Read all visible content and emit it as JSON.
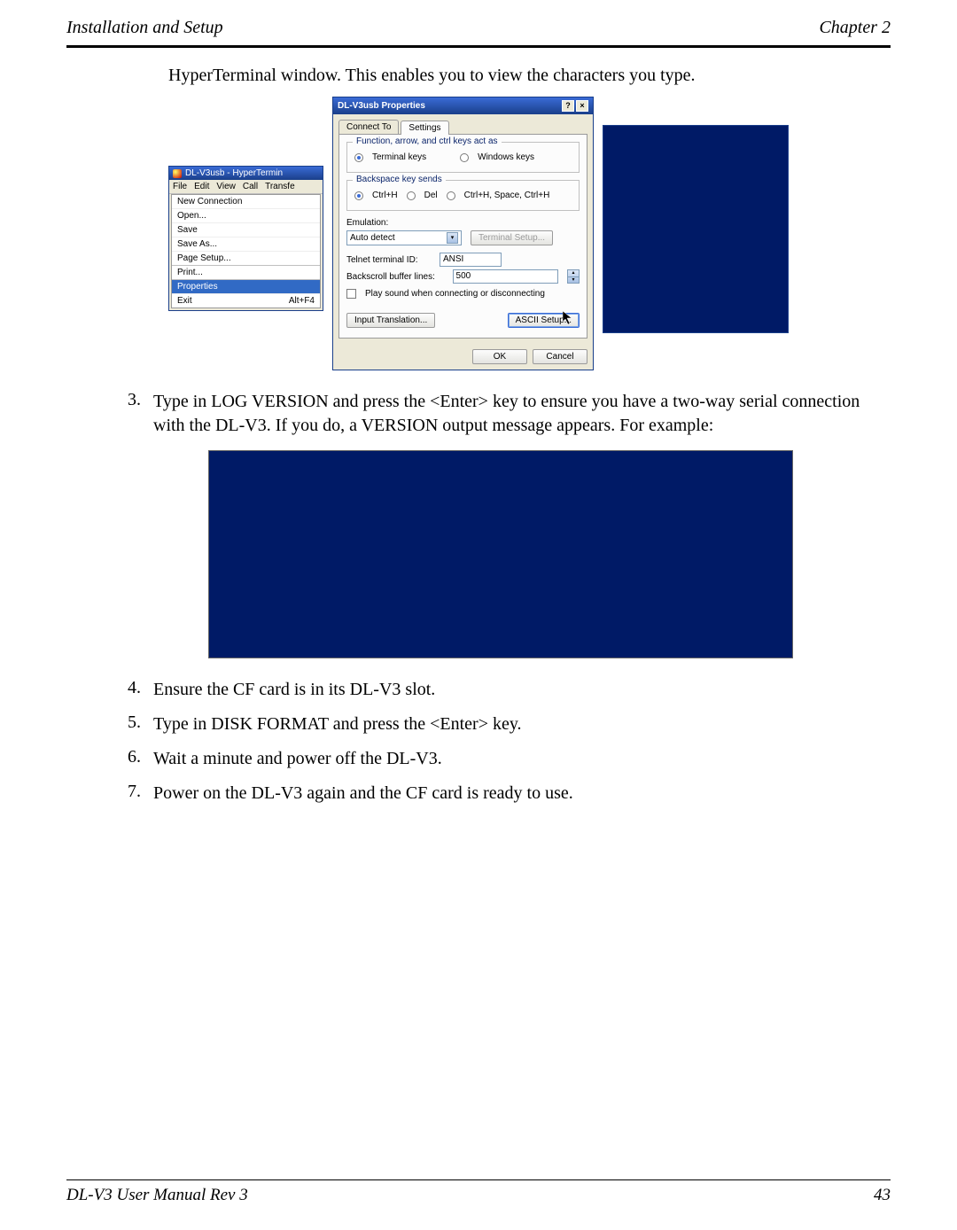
{
  "header": {
    "left": "Installation and Setup",
    "right": "Chapter 2"
  },
  "intro": "HyperTerminal window. This enables you to view the characters you type.",
  "ht": {
    "title": "DL-V3usb - HyperTermin",
    "menubar": [
      "File",
      "Edit",
      "View",
      "Call",
      "Transfe"
    ],
    "file_menu": {
      "items": [
        "New Connection",
        "Open...",
        "Save",
        "Save As...",
        "Page Setup...",
        "Print..."
      ],
      "selected": "Properties",
      "exit": "Exit",
      "exit_sc": "Alt+F4"
    }
  },
  "props": {
    "title": "DL-V3usb Properties",
    "tabs": {
      "t1": "Connect To",
      "t2": "Settings"
    },
    "group1": {
      "legend": "Function, arrow, and ctrl keys act as",
      "opt1": "Terminal keys",
      "opt2": "Windows keys"
    },
    "group2": {
      "legend": "Backspace key sends",
      "opt1": "Ctrl+H",
      "opt2": "Del",
      "opt3": "Ctrl+H, Space, Ctrl+H"
    },
    "emul_label": "Emulation:",
    "emul_value": "Auto detect",
    "term_setup": "Terminal Setup...",
    "telnet_label": "Telnet terminal ID:",
    "telnet_value": "ANSI",
    "backscroll_label": "Backscroll buffer lines:",
    "backscroll_value": "500",
    "play_sound": "Play sound when connecting or disconnecting",
    "input_trans": "Input Translation...",
    "ascii_setup": "ASCII Setup...",
    "ok": "OK",
    "cancel": "Cancel"
  },
  "steps": {
    "s3": "Type in LOG VERSION and press the <Enter> key to ensure you have a two-way serial connection with the DL-V3. If you do, a VERSION output message appears. For example:",
    "s4": "Ensure the CF card is in its DL-V3 slot.",
    "s5": "Type in DISK FORMAT and press the <Enter> key.",
    "s6": "Wait a minute and power off the DL-V3.",
    "s7": "Power on the DL-V3 again and the CF card is ready to use."
  },
  "footer": {
    "left": "DL-V3 User Manual Rev 3",
    "right": "43"
  }
}
